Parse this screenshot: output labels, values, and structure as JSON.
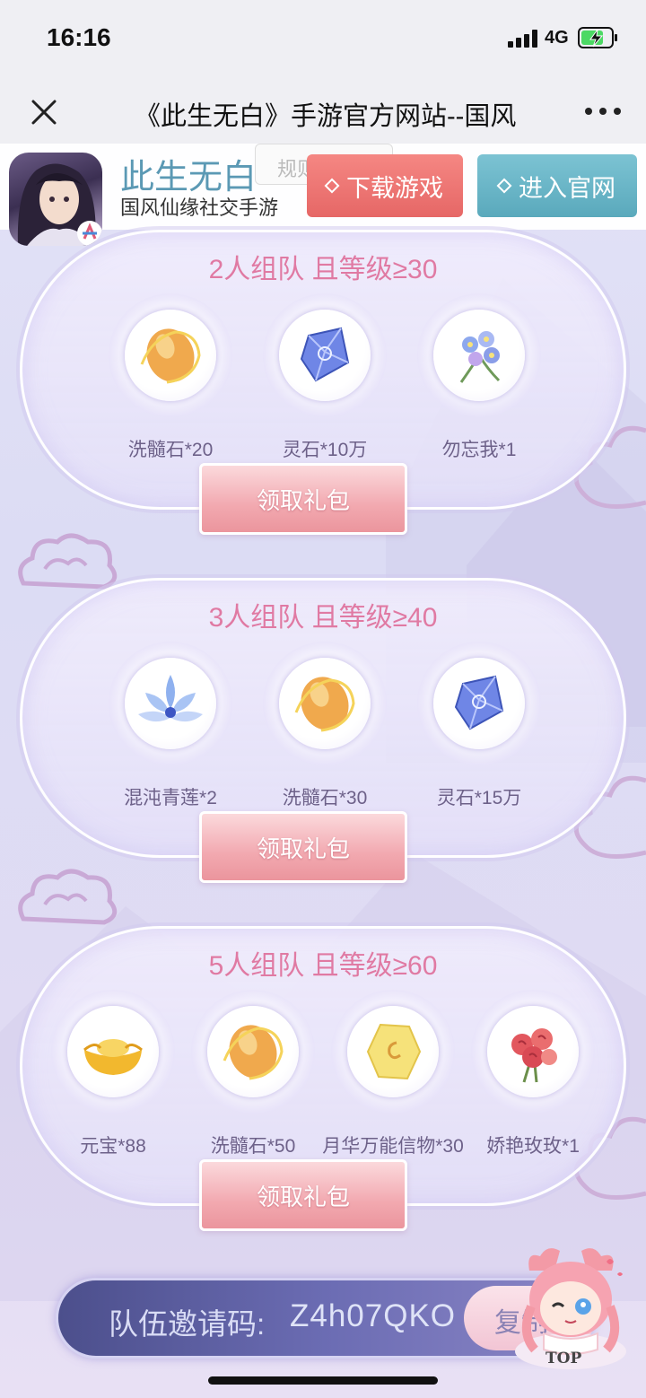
{
  "status_bar": {
    "time": "16:16",
    "network": "4G"
  },
  "nav": {
    "title": "《此生无白》手游官方网站--国风"
  },
  "app_banner": {
    "name": "此生无白",
    "subtitle": "国风仙缘社交手游",
    "rules_label": "规则",
    "download_label": "下载游戏",
    "official_label": "进入官网"
  },
  "cards": [
    {
      "title": "2人组队 且等级≥30",
      "items": [
        {
          "icon": "marrow-stone-icon",
          "label": "洗髓石*20"
        },
        {
          "icon": "spirit-stone-icon",
          "label": "灵石*10万"
        },
        {
          "icon": "forget-me-not-icon",
          "label": "勿忘我*1"
        }
      ],
      "claim_label": "领取礼包"
    },
    {
      "title": "3人组队 且等级≥40",
      "items": [
        {
          "icon": "chaos-lotus-icon",
          "label": "混沌青莲*2"
        },
        {
          "icon": "marrow-stone-icon",
          "label": "洗髓石*30"
        },
        {
          "icon": "spirit-stone-icon",
          "label": "灵石*15万"
        }
      ],
      "claim_label": "领取礼包"
    },
    {
      "title": "5人组队 且等级≥60",
      "items": [
        {
          "icon": "gold-ingot-icon",
          "label": "元宝*88"
        },
        {
          "icon": "marrow-stone-icon",
          "label": "洗髓石*50"
        },
        {
          "icon": "moon-token-icon",
          "label": "月华万能信物*30"
        },
        {
          "icon": "rose-bouquet-icon",
          "label": "娇艳玫玫*1"
        }
      ],
      "claim_label": "领取礼包"
    }
  ],
  "invite": {
    "label": "队伍邀请码:",
    "code": "Z4h07QKO",
    "copy_label": "复制"
  },
  "top_button": {
    "label": "TOP"
  },
  "colors": {
    "title_pink": "#e07aa3",
    "download_red": "#e66766",
    "official_teal": "#5aa9bc",
    "invite_blue": "#5b5da0"
  }
}
